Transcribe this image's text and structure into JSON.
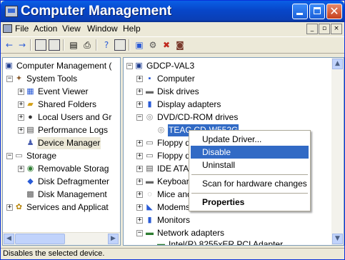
{
  "window": {
    "title": "Computer Management"
  },
  "menu": [
    "File",
    "Action",
    "View",
    "Window",
    "Help"
  ],
  "left_tree": {
    "root": "Computer Management (",
    "system_tools": "System Tools",
    "event_viewer": "Event Viewer",
    "shared_folders": "Shared Folders",
    "local_users": "Local Users and Gr",
    "perf_logs": "Performance Logs",
    "device_manager": "Device Manager",
    "storage": "Storage",
    "removable_storage": "Removable Storag",
    "disk_defrag": "Disk Defragmenter",
    "disk_mgmt": "Disk Management",
    "services": "Services and Applicat"
  },
  "right_tree": {
    "root": "GDCP-VAL3",
    "computer": "Computer",
    "disk_drives": "Disk drives",
    "display_adapters": "Display adapters",
    "dvd_drives": "DVD/CD-ROM drives",
    "teac": "TEAC CD-W552G",
    "floppy1": "Floppy di",
    "floppy2": "Floppy di",
    "ide": "IDE ATA",
    "keyboards": "Keyboarc",
    "mice": "Mice and",
    "modems": "Modems",
    "monitors": "Monitors",
    "network": "Network adapters",
    "intel": "Intel(R) 8255xER PCI Adapter"
  },
  "context_menu": {
    "update_driver": "Update Driver...",
    "disable": "Disable",
    "uninstall": "Uninstall",
    "scan": "Scan for hardware changes",
    "properties": "Properties"
  },
  "status": "Disables the selected device."
}
